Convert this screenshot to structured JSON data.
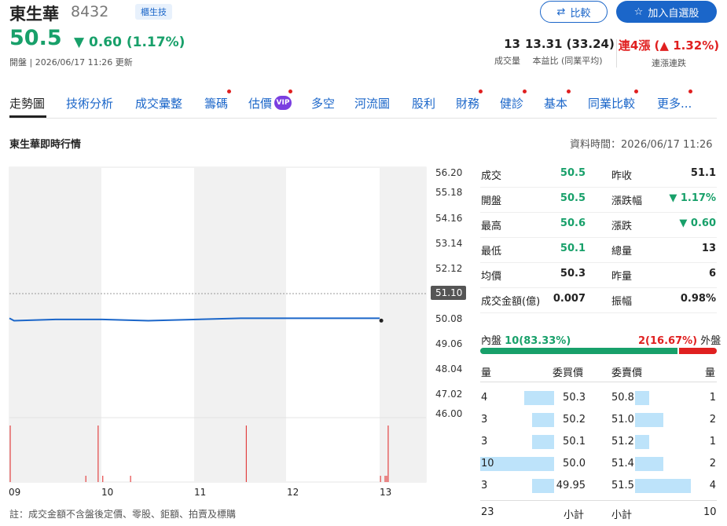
{
  "header": {
    "name": "東生華",
    "code": "8432",
    "badge": "櫃生技",
    "price": "50.5",
    "change": "0.60 (1.17%)",
    "status": "開盤 | 2026/06/17 11:26 更新",
    "compare_label": "比較",
    "watch_label": "加入自選股",
    "stats": [
      {
        "value": "13",
        "label": "成交量"
      },
      {
        "value": "13.31 (33.24)",
        "label": "本益比 (同業平均)"
      },
      {
        "value": "連4漲 (",
        "label": "連漲連跌",
        "value2": "1.32%)"
      }
    ]
  },
  "tabs": [
    "走勢圖",
    "技術分析",
    "成交彙整",
    "籌碼",
    "估價",
    "多空",
    "河流圖",
    "股利",
    "財務",
    "健診",
    "基本",
    "同業比較",
    "更多..."
  ],
  "vip": "VIP",
  "section": {
    "title": "東生華即時行情",
    "time": "資料時間：2026/06/17 11:26"
  },
  "chart_data": {
    "type": "line",
    "title": "",
    "x_labels": [
      "09",
      "10",
      "11",
      "12",
      "13"
    ],
    "y_ticks": [
      "56.20",
      "55.18",
      "54.16",
      "53.14",
      "52.12",
      "51.10",
      "50.08",
      "49.06",
      "48.04",
      "47.02",
      "46.00"
    ],
    "prev_close": "51.10",
    "series": [
      {
        "values": [
          [
            0,
            50.1
          ],
          [
            3,
            50.0
          ],
          [
            30,
            50.05
          ],
          [
            60,
            50.05
          ],
          [
            90,
            50.0
          ],
          [
            150,
            50.1
          ],
          [
            240,
            50.1
          ]
        ]
      }
    ],
    "volume_marks": [
      0,
      49,
      57,
      60,
      78,
      153,
      240,
      243,
      244,
      245
    ],
    "x_range": [
      0,
      270
    ]
  },
  "quote": {
    "left": [
      {
        "k": "成交",
        "v": "50.5"
      },
      {
        "k": "開盤",
        "v": "50.5"
      },
      {
        "k": "最高",
        "v": "50.6"
      },
      {
        "k": "最低",
        "v": "50.1"
      },
      {
        "k": "均價",
        "v": "50.3"
      },
      {
        "k": "成交金額(億)",
        "v": "0.007"
      }
    ],
    "right": [
      {
        "k": "昨收",
        "v": "51.1"
      },
      {
        "k": "漲跌幅",
        "v": "1.17%"
      },
      {
        "k": "漲跌",
        "v": "0.60"
      },
      {
        "k": "總量",
        "v": "13"
      },
      {
        "k": "昨量",
        "v": "6"
      },
      {
        "k": "振幅",
        "v": "0.98%"
      }
    ]
  },
  "inout": {
    "inner_label": "內盤",
    "inner_value": "10(83.33%)",
    "outer_value": "2(16.67%)",
    "outer_label": "外盤",
    "inner_ratio": 0.8333
  },
  "orderbook": {
    "h_qty": "量",
    "h_bid": "委買價",
    "h_ask": "委賣價",
    "h_qty2": "量",
    "bids": [
      {
        "q": "4",
        "p": "50.3",
        "f": 0.4
      },
      {
        "q": "3",
        "p": "50.2",
        "f": 0.3
      },
      {
        "q": "3",
        "p": "50.1",
        "f": 0.3
      },
      {
        "q": "10",
        "p": "50.0",
        "f": 1.0
      },
      {
        "q": "3",
        "p": "49.95",
        "f": 0.3
      }
    ],
    "asks": [
      {
        "p": "50.8",
        "q": "1",
        "f": 0.25
      },
      {
        "p": "51.0",
        "q": "2",
        "f": 0.5
      },
      {
        "p": "51.2",
        "q": "1",
        "f": 0.25
      },
      {
        "p": "51.4",
        "q": "2",
        "f": 0.5
      },
      {
        "p": "51.5",
        "q": "4",
        "f": 1.0
      }
    ],
    "bid_total": "23",
    "subtotal": "小計",
    "ask_subtotal": "小計",
    "ask_total": "10"
  },
  "note": "註：成交金額不含盤後定價、零股、鉅額、拍賣及標購"
}
